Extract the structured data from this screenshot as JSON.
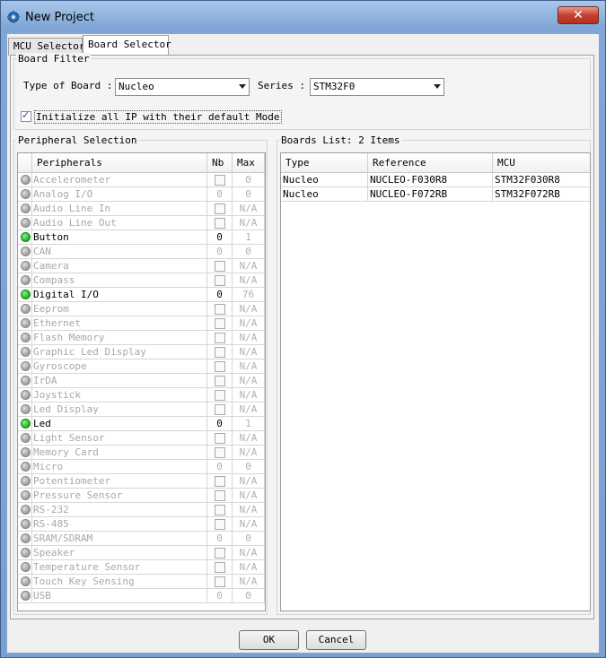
{
  "window": {
    "title": "New Project",
    "close_label": "✕"
  },
  "tabs": [
    {
      "label": "MCU Selector",
      "active": false
    },
    {
      "label": "Board Selector",
      "active": true
    }
  ],
  "board_filter": {
    "legend": "Board Filter",
    "type_label": "Type of Board :",
    "type_value": "Nucleo",
    "series_label": "Series :",
    "series_value": "STM32F0",
    "init_label": "Initialize all IP with their default Mode",
    "init_checked": true
  },
  "peripheral_selection": {
    "legend": "Peripheral Selection",
    "headers": {
      "name": "Peripherals",
      "nb": "Nb",
      "max": "Max"
    },
    "rows": [
      {
        "name": "Accelerometer",
        "status": "gray",
        "nb_type": "check",
        "nb": "",
        "max": "0"
      },
      {
        "name": "Analog I/O",
        "status": "gray",
        "nb_type": "text",
        "nb": "0",
        "max": "0"
      },
      {
        "name": "Audio Line In",
        "status": "gray",
        "nb_type": "check",
        "nb": "",
        "max": "N/A"
      },
      {
        "name": "Audio Line Out",
        "status": "gray",
        "nb_type": "check",
        "nb": "",
        "max": "N/A"
      },
      {
        "name": "Button",
        "status": "green",
        "nb_type": "text",
        "nb": "0",
        "max": "1"
      },
      {
        "name": "CAN",
        "status": "gray",
        "nb_type": "text",
        "nb": "0",
        "max": "0"
      },
      {
        "name": "Camera",
        "status": "gray",
        "nb_type": "check",
        "nb": "",
        "max": "N/A"
      },
      {
        "name": "Compass",
        "status": "gray",
        "nb_type": "check",
        "nb": "",
        "max": "N/A"
      },
      {
        "name": "Digital I/O",
        "status": "green",
        "nb_type": "text",
        "nb": "0",
        "max": "76"
      },
      {
        "name": "Eeprom",
        "status": "gray",
        "nb_type": "check",
        "nb": "",
        "max": "N/A"
      },
      {
        "name": "Ethernet",
        "status": "gray",
        "nb_type": "check",
        "nb": "",
        "max": "N/A"
      },
      {
        "name": "Flash Memory",
        "status": "gray",
        "nb_type": "check",
        "nb": "",
        "max": "N/A"
      },
      {
        "name": "Graphic Led Display",
        "status": "gray",
        "nb_type": "check",
        "nb": "",
        "max": "N/A"
      },
      {
        "name": "Gyroscope",
        "status": "gray",
        "nb_type": "check",
        "nb": "",
        "max": "N/A"
      },
      {
        "name": "IrDA",
        "status": "gray",
        "nb_type": "check",
        "nb": "",
        "max": "N/A"
      },
      {
        "name": "Joystick",
        "status": "gray",
        "nb_type": "check",
        "nb": "",
        "max": "N/A"
      },
      {
        "name": "Led Display",
        "status": "gray",
        "nb_type": "check",
        "nb": "",
        "max": "N/A"
      },
      {
        "name": "Led",
        "status": "green",
        "nb_type": "text",
        "nb": "0",
        "max": "1"
      },
      {
        "name": "Light Sensor",
        "status": "gray",
        "nb_type": "check",
        "nb": "",
        "max": "N/A"
      },
      {
        "name": "Memory Card",
        "status": "gray",
        "nb_type": "check",
        "nb": "",
        "max": "N/A"
      },
      {
        "name": "Micro",
        "status": "gray",
        "nb_type": "text",
        "nb": "0",
        "max": "0"
      },
      {
        "name": "Potentiometer",
        "status": "gray",
        "nb_type": "check",
        "nb": "",
        "max": "N/A"
      },
      {
        "name": "Pressure Sensor",
        "status": "gray",
        "nb_type": "check",
        "nb": "",
        "max": "N/A"
      },
      {
        "name": "RS-232",
        "status": "gray",
        "nb_type": "check",
        "nb": "",
        "max": "N/A"
      },
      {
        "name": "RS-485",
        "status": "gray",
        "nb_type": "check",
        "nb": "",
        "max": "N/A"
      },
      {
        "name": "SRAM/SDRAM",
        "status": "gray",
        "nb_type": "text",
        "nb": "0",
        "max": "0"
      },
      {
        "name": "Speaker",
        "status": "gray",
        "nb_type": "check",
        "nb": "",
        "max": "N/A"
      },
      {
        "name": "Temperature Sensor",
        "status": "gray",
        "nb_type": "check",
        "nb": "",
        "max": "N/A"
      },
      {
        "name": "Touch Key Sensing",
        "status": "gray",
        "nb_type": "check",
        "nb": "",
        "max": "N/A"
      },
      {
        "name": "USB",
        "status": "gray",
        "nb_type": "text",
        "nb": "0",
        "max": "0"
      }
    ]
  },
  "boards_list": {
    "legend": "Boards List: 2 Items",
    "headers": {
      "type": "Type",
      "reference": "Reference",
      "mcu": "MCU"
    },
    "rows": [
      {
        "type": "Nucleo",
        "reference": "NUCLEO-F030R8",
        "mcu": "STM32F030R8"
      },
      {
        "type": "Nucleo",
        "reference": "NUCLEO-F072RB",
        "mcu": "STM32F072RB"
      }
    ]
  },
  "buttons": {
    "ok": "OK",
    "cancel": "Cancel"
  },
  "colors": {
    "status_green": "#1fae1f",
    "status_gray": "#9a9a9a",
    "disabled_text": "#a8a8a8"
  }
}
